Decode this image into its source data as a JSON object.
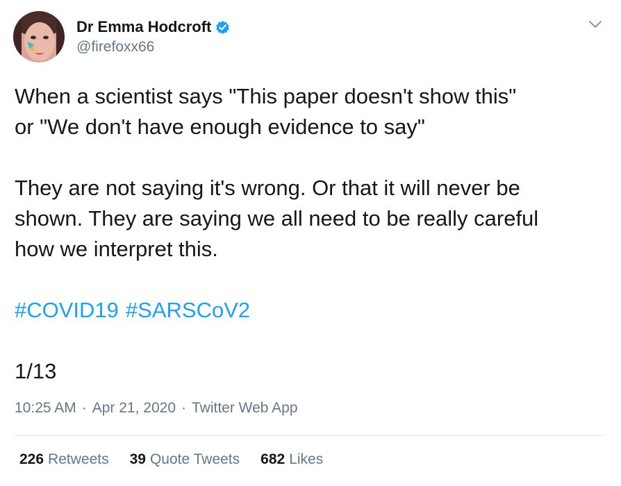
{
  "author": {
    "display_name": "Dr Emma Hodcroft",
    "handle": "@firefoxx66",
    "verified": true
  },
  "tweet": {
    "line1": "When a scientist says \"This paper doesn't show this\"",
    "line2": "or \"We don't have enough evidence to say\"",
    "line3": "They are not saying it's wrong. Or that it will never be",
    "line4": "shown. They are saying we all need to be really careful",
    "line5": "how we interpret this.",
    "hashtags": [
      "#COVID19",
      "#SARSCoV2"
    ],
    "thread_count": "1/13"
  },
  "meta": {
    "time": "10:25 AM",
    "sep1": "·",
    "date": "Apr 21, 2020",
    "sep2": "·",
    "source": "Twitter Web App"
  },
  "stats": {
    "retweets": {
      "count": "226",
      "label": "Retweets"
    },
    "quote_tweets": {
      "count": "39",
      "label": "Quote Tweets"
    },
    "likes": {
      "count": "682",
      "label": "Likes"
    }
  },
  "colors": {
    "link": "#1da1f2",
    "secondary_text": "#657786",
    "primary_text": "#14171a",
    "divider": "#e1e8ed"
  }
}
